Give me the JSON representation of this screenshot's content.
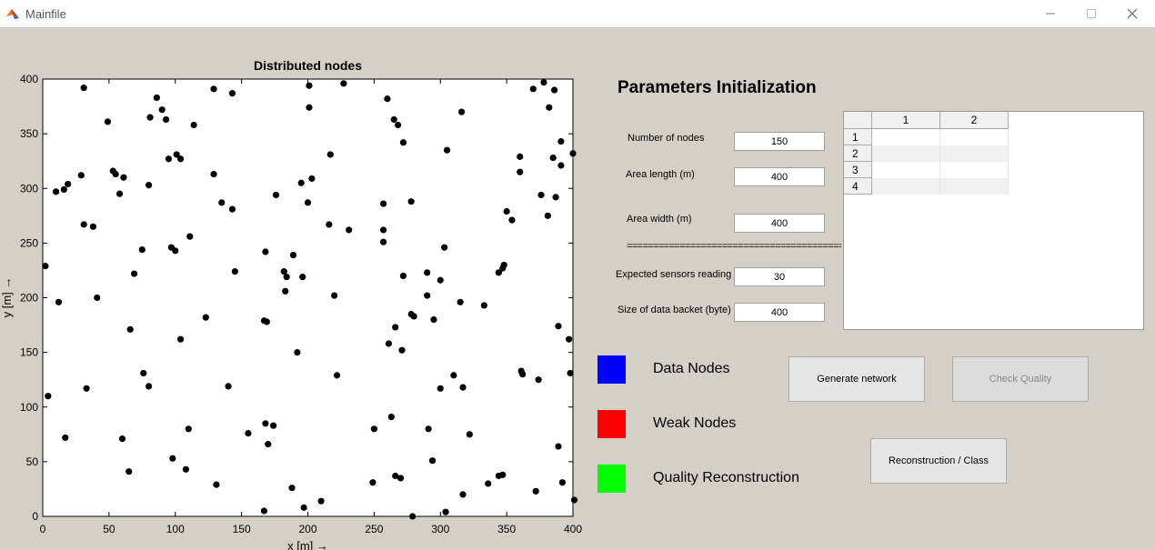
{
  "window": {
    "title": "Mainfile"
  },
  "plot": {
    "title": "Distributed nodes",
    "xlabel": "x  [m] →",
    "ylabel": "y  [m] →",
    "xlim": [
      0,
      400
    ],
    "ylim": [
      0,
      400
    ],
    "xticks": [
      "0",
      "50",
      "100",
      "150",
      "200",
      "250",
      "300",
      "350",
      "400"
    ],
    "yticks": [
      "0",
      "50",
      "100",
      "150",
      "200",
      "250",
      "300",
      "350",
      "400"
    ],
    "point_color": "#000000",
    "points": [
      [
        31,
        392
      ],
      [
        86,
        383
      ],
      [
        129,
        391
      ],
      [
        143,
        387
      ],
      [
        201,
        394
      ],
      [
        227,
        396
      ],
      [
        260,
        382
      ],
      [
        370,
        391
      ],
      [
        378,
        397
      ],
      [
        386,
        390
      ],
      [
        49,
        361
      ],
      [
        81,
        365
      ],
      [
        90,
        372
      ],
      [
        93,
        363
      ],
      [
        114,
        358
      ],
      [
        201,
        374
      ],
      [
        316,
        370
      ],
      [
        382,
        374
      ],
      [
        265,
        363
      ],
      [
        268,
        358
      ],
      [
        272,
        342
      ],
      [
        305,
        335
      ],
      [
        391,
        343
      ],
      [
        400,
        332
      ],
      [
        10,
        297
      ],
      [
        16,
        299
      ],
      [
        19,
        304
      ],
      [
        29,
        312
      ],
      [
        53,
        316
      ],
      [
        55,
        313
      ],
      [
        58,
        295
      ],
      [
        61,
        310
      ],
      [
        80,
        303
      ],
      [
        95,
        327
      ],
      [
        101,
        331
      ],
      [
        104,
        327
      ],
      [
        129,
        313
      ],
      [
        135,
        287
      ],
      [
        143,
        281
      ],
      [
        176,
        294
      ],
      [
        195,
        305
      ],
      [
        200,
        287
      ],
      [
        203,
        309
      ],
      [
        217,
        331
      ],
      [
        257,
        286
      ],
      [
        278,
        288
      ],
      [
        360,
        315
      ],
      [
        360,
        329
      ],
      [
        376,
        294
      ],
      [
        385,
        328
      ],
      [
        391,
        321
      ],
      [
        387,
        292
      ],
      [
        350,
        279
      ],
      [
        354,
        271
      ],
      [
        381,
        275
      ],
      [
        31,
        267
      ],
      [
        38,
        265
      ],
      [
        75,
        244
      ],
      [
        97,
        246
      ],
      [
        100,
        243
      ],
      [
        111,
        256
      ],
      [
        216,
        267
      ],
      [
        231,
        262
      ],
      [
        257,
        262
      ],
      [
        257,
        251
      ],
      [
        303,
        246
      ],
      [
        2,
        229
      ],
      [
        69,
        222
      ],
      [
        145,
        224
      ],
      [
        168,
        242
      ],
      [
        182,
        224
      ],
      [
        184,
        219
      ],
      [
        189,
        239
      ],
      [
        196,
        219
      ],
      [
        183,
        206
      ],
      [
        220,
        202
      ],
      [
        272,
        220
      ],
      [
        290,
        223
      ],
      [
        300,
        216
      ],
      [
        315,
        196
      ],
      [
        333,
        193
      ],
      [
        344,
        223
      ],
      [
        347,
        227
      ],
      [
        348,
        230
      ],
      [
        12,
        196
      ],
      [
        41,
        200
      ],
      [
        66,
        171
      ],
      [
        76,
        131
      ],
      [
        80,
        119
      ],
      [
        104,
        162
      ],
      [
        123,
        182
      ],
      [
        140,
        119
      ],
      [
        167,
        179
      ],
      [
        169,
        178
      ],
      [
        192,
        150
      ],
      [
        222,
        129
      ],
      [
        261,
        158
      ],
      [
        266,
        173
      ],
      [
        271,
        152
      ],
      [
        278,
        185
      ],
      [
        280,
        183
      ],
      [
        290,
        202
      ],
      [
        295,
        180
      ],
      [
        300,
        117
      ],
      [
        310,
        129
      ],
      [
        317,
        118
      ],
      [
        374,
        125
      ],
      [
        361,
        133
      ],
      [
        362,
        130
      ],
      [
        389,
        174
      ],
      [
        397,
        162
      ],
      [
        398,
        131
      ],
      [
        4,
        110
      ],
      [
        17,
        72
      ],
      [
        33,
        117
      ],
      [
        60,
        71
      ],
      [
        65,
        41
      ],
      [
        98,
        53
      ],
      [
        108,
        43
      ],
      [
        110,
        80
      ],
      [
        131,
        29
      ],
      [
        155,
        76
      ],
      [
        167,
        5
      ],
      [
        168,
        85
      ],
      [
        170,
        66
      ],
      [
        174,
        83
      ],
      [
        188,
        26
      ],
      [
        197,
        8
      ],
      [
        210,
        14
      ],
      [
        249,
        31
      ],
      [
        250,
        80
      ],
      [
        263,
        91
      ],
      [
        266,
        37
      ],
      [
        270,
        35
      ],
      [
        279,
        0
      ],
      [
        291,
        80
      ],
      [
        294,
        51
      ],
      [
        304,
        4
      ],
      [
        317,
        20
      ],
      [
        322,
        75
      ],
      [
        336,
        30
      ],
      [
        344,
        37
      ],
      [
        347,
        38
      ],
      [
        372,
        23
      ],
      [
        389,
        64
      ],
      [
        392,
        31
      ],
      [
        401,
        15
      ]
    ]
  },
  "params": {
    "heading": "Parameters Initialization",
    "fields": [
      {
        "label": "Number of nodes",
        "value": "150"
      },
      {
        "label": "Area length (m)",
        "value": "400"
      },
      {
        "label": "Area width (m)",
        "value": "400"
      },
      {
        "label": "Expected sensors reading",
        "value": "30"
      },
      {
        "label": "Size of data backet (byte)",
        "value": "400"
      }
    ],
    "separator": "========================================================"
  },
  "table": {
    "columns": [
      "1",
      "2"
    ],
    "rows": [
      "1",
      "2",
      "3",
      "4"
    ],
    "row_colors": [
      "#ffffff",
      "#f0f0f0",
      "#ffffff",
      "#f0f0f0"
    ]
  },
  "legend": [
    {
      "label": "Data Nodes",
      "color": "#0000ff"
    },
    {
      "label": "Weak Nodes",
      "color": "#ff0000"
    },
    {
      "label": "Quality Reconstruction",
      "color": "#00ff00"
    }
  ],
  "buttons": {
    "generate": "Generate network",
    "check": "Check Quality",
    "reconstruct": "Reconstruction / Class"
  }
}
